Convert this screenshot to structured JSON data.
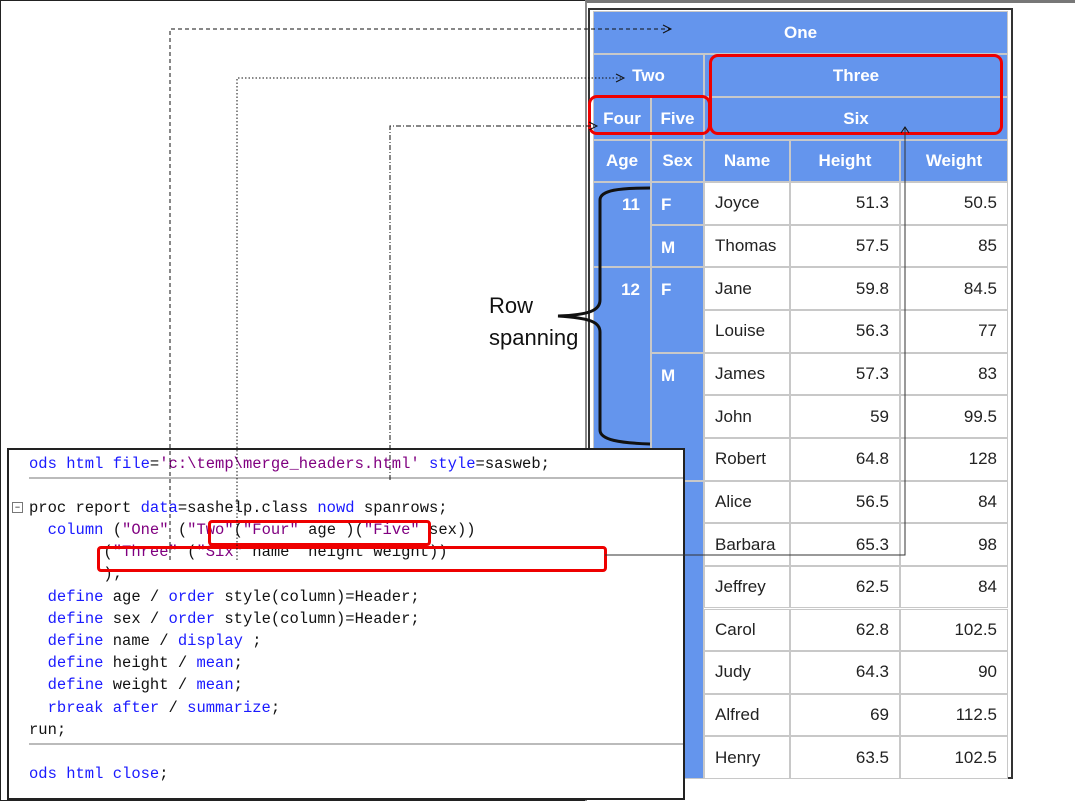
{
  "annotation": {
    "label_line1": "Row",
    "label_line2": "spanning"
  },
  "table": {
    "header_rows": {
      "one": "One",
      "two": "Two",
      "three": "Three",
      "four": "Four",
      "five": "Five",
      "six": "Six"
    },
    "columns": [
      "Age",
      "Sex",
      "Name",
      "Height",
      "Weight"
    ],
    "age_groups": [
      {
        "label": "11",
        "rows": 2
      },
      {
        "label": "12",
        "rows": 5
      },
      {
        "label": "",
        "rows": 7
      }
    ],
    "sex_groups": [
      {
        "label": "F",
        "rows": 1
      },
      {
        "label": "M",
        "rows": 1
      },
      {
        "label": "F",
        "rows": 2
      },
      {
        "label": "M",
        "rows": 3
      },
      {
        "label": "",
        "rows": 7
      }
    ],
    "rows": [
      {
        "name": "Joyce",
        "height": "51.3",
        "weight": "50.5"
      },
      {
        "name": "Thomas",
        "height": "57.5",
        "weight": "85"
      },
      {
        "name": "Jane",
        "height": "59.8",
        "weight": "84.5"
      },
      {
        "name": "Louise",
        "height": "56.3",
        "weight": "77"
      },
      {
        "name": "James",
        "height": "57.3",
        "weight": "83"
      },
      {
        "name": "John",
        "height": "59",
        "weight": "99.5"
      },
      {
        "name": "Robert",
        "height": "64.8",
        "weight": "128"
      },
      {
        "name": "Alice",
        "height": "56.5",
        "weight": "84"
      },
      {
        "name": "Barbara",
        "height": "65.3",
        "weight": "98"
      },
      {
        "name": "Jeffrey",
        "height": "62.5",
        "weight": "84"
      },
      {
        "name": "Carol",
        "height": "62.8",
        "weight": "102.5"
      },
      {
        "name": "Judy",
        "height": "64.3",
        "weight": "90"
      },
      {
        "name": "Alfred",
        "height": "69",
        "weight": "112.5"
      },
      {
        "name": "Henry",
        "height": "63.5",
        "weight": "102.5"
      }
    ]
  },
  "code": {
    "l1": [
      [
        "kw",
        "ods html file"
      ],
      [
        "tx",
        "="
      ],
      [
        "st",
        "'c:\\temp\\merge_headers.html'"
      ],
      [
        "tx",
        " "
      ],
      [
        "kw",
        "style"
      ],
      [
        "tx",
        "=sasweb;"
      ]
    ],
    "l2": [
      [
        "tx",
        "proc report "
      ],
      [
        "kw",
        "data"
      ],
      [
        "tx",
        "=sashelp.class "
      ],
      [
        "kw",
        "nowd"
      ],
      [
        "tx",
        " spanrows;"
      ]
    ],
    "l3": [
      [
        "tx",
        "  "
      ],
      [
        "kw",
        "column"
      ],
      [
        "tx",
        " ("
      ],
      [
        "st",
        "\"One\""
      ],
      [
        "tx",
        " ("
      ],
      [
        "st",
        "\"Two\""
      ],
      [
        "tx",
        "("
      ],
      [
        "st",
        "\"Four\""
      ],
      [
        "tx",
        " age )("
      ],
      [
        "st",
        "\"Five\""
      ],
      [
        "tx",
        " sex))"
      ]
    ],
    "l4": [
      [
        "tx",
        "        ("
      ],
      [
        "st",
        "\"Three\""
      ],
      [
        "tx",
        " ("
      ],
      [
        "st",
        "\"Six\""
      ],
      [
        "tx",
        " name  height weight))"
      ]
    ],
    "l5": [
      [
        "tx",
        "        );"
      ]
    ],
    "l6": [
      [
        "tx",
        "  "
      ],
      [
        "kw",
        "define"
      ],
      [
        "tx",
        " age / "
      ],
      [
        "kw",
        "order"
      ],
      [
        "tx",
        " style(column)=Header;"
      ]
    ],
    "l7": [
      [
        "tx",
        "  "
      ],
      [
        "kw",
        "define"
      ],
      [
        "tx",
        " sex / "
      ],
      [
        "kw",
        "order"
      ],
      [
        "tx",
        " style(column)=Header;"
      ]
    ],
    "l8": [
      [
        "tx",
        "  "
      ],
      [
        "kw",
        "define"
      ],
      [
        "tx",
        " name / "
      ],
      [
        "kw",
        "display"
      ],
      [
        "tx",
        " ;"
      ]
    ],
    "l9": [
      [
        "tx",
        "  "
      ],
      [
        "kw",
        "define"
      ],
      [
        "tx",
        " height / "
      ],
      [
        "kw",
        "mean"
      ],
      [
        "tx",
        ";"
      ]
    ],
    "l10": [
      [
        "tx",
        "  "
      ],
      [
        "kw",
        "define"
      ],
      [
        "tx",
        " weight / "
      ],
      [
        "kw",
        "mean"
      ],
      [
        "tx",
        ";"
      ]
    ],
    "l11": [
      [
        "tx",
        "  "
      ],
      [
        "kw",
        "rbreak after"
      ],
      [
        "tx",
        " / "
      ],
      [
        "kw",
        "summarize"
      ],
      [
        "tx",
        ";"
      ]
    ],
    "l12": [
      [
        "tx",
        "run;"
      ]
    ],
    "l13": [
      [
        "kw",
        "ods html close"
      ],
      [
        "tx",
        ";"
      ]
    ]
  },
  "colors": {
    "header_blue": "#6495ed",
    "highlight_red": "#e00000"
  }
}
